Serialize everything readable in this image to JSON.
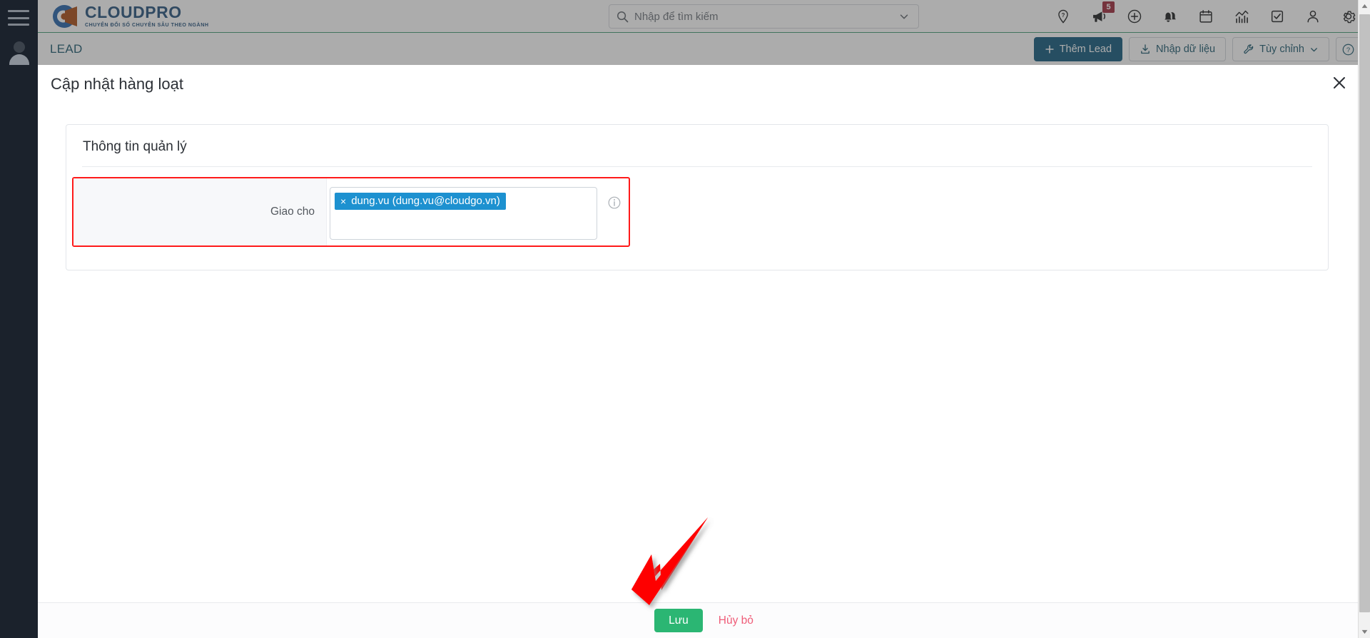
{
  "sidebar": {
    "menu_icon": "hamburger-menu-icon",
    "avatar_icon": "user-avatar-icon"
  },
  "topbar": {
    "logo_title": "CLOUDPRO",
    "logo_tagline": "CHUYỂN ĐỔI SỐ CHUYÊN SÂU THEO NGÀNH",
    "search": {
      "placeholder": "Nhập để tìm kiếm",
      "value": "",
      "icon": "search-icon",
      "caret_icon": "chevron-down-icon"
    },
    "icons": [
      {
        "name": "location-help-pin-icon",
        "badge": ""
      },
      {
        "name": "megaphone-icon",
        "badge": "5"
      },
      {
        "name": "plus-circle-icon",
        "badge": ""
      },
      {
        "name": "bells-icon",
        "badge": ""
      },
      {
        "name": "calendar-icon",
        "badge": ""
      },
      {
        "name": "chart-icon",
        "badge": ""
      },
      {
        "name": "checkbox-task-icon",
        "badge": ""
      },
      {
        "name": "person-icon",
        "badge": ""
      },
      {
        "name": "gear-settings-icon",
        "badge": ""
      }
    ],
    "badge_color": "#9b2335",
    "accent_green": "#3d9970"
  },
  "modulebar": {
    "title": "LEAD",
    "title_color": "#17556b",
    "buttons": {
      "add_lead": "Thêm Lead",
      "import_data": "Nhập dữ liệu",
      "customize": "Tùy chỉnh",
      "help": "?"
    },
    "primary_color": "#0b5579"
  },
  "modal": {
    "title": "Cập nhật hàng loạt",
    "close_icon": "close-icon",
    "card": {
      "title": "Thông tin quản lý",
      "fields": [
        {
          "label": "Giao cho",
          "highlight_color": "#ff1a1a",
          "tag": {
            "remove_icon": "×",
            "text": "dung.vu (dung.vu@cloudgo.vn)",
            "color": "#1d91d0"
          },
          "info_icon": "info-circle-icon"
        }
      ]
    },
    "footer": {
      "save_label": "Lưu",
      "save_color": "#2bb673",
      "cancel_label": "Hủy bỏ",
      "cancel_color": "#ef5c78"
    }
  },
  "annotation": {
    "arrow_icon": "red-pointer-arrow",
    "arrow_color": "#fe0000"
  },
  "scrollbar": {
    "up_icon": "scroll-up-arrow-icon",
    "down_icon": "scroll-down-arrow-icon",
    "thumb": "scroll-thumb"
  }
}
